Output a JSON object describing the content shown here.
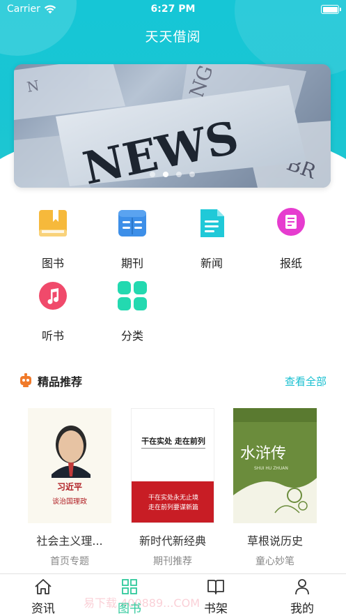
{
  "status_bar": {
    "carrier": "Carrier",
    "time": "6:27 PM"
  },
  "app": {
    "title": "天天借阅"
  },
  "banner": {
    "headline": "NEWS",
    "page_count": 4,
    "active_page": 1
  },
  "categories": [
    {
      "label": "图书",
      "icon": "book-icon",
      "color": "#f6b93b"
    },
    {
      "label": "期刊",
      "icon": "magazine-icon",
      "color": "#3d8fe8"
    },
    {
      "label": "新闻",
      "icon": "news-document-icon",
      "color": "#20c9d8"
    },
    {
      "label": "报纸",
      "icon": "newspaper-icon",
      "color": "#e63ccf"
    },
    {
      "label": "听书",
      "icon": "music-note-icon",
      "color": "#f04a6b"
    },
    {
      "label": "分类",
      "icon": "grid-category-icon",
      "color": "#23d9b0"
    }
  ],
  "recommend": {
    "title": "精品推荐",
    "view_all": "查看全部",
    "books": [
      {
        "title": "社会主义理...",
        "subtitle": "首页专题",
        "cover_text": [
          "习近平",
          "谈治国理政"
        ]
      },
      {
        "title": "新时代新经典",
        "subtitle": "期刊推荐",
        "cover_text": [
          "干在实处 走在前列",
          "干在实处永无止境",
          "走在前列要谋新篇"
        ]
      },
      {
        "title": "草根说历史",
        "subtitle": "童心妙笔",
        "cover_text": [
          "水浒传",
          "SHUI HU ZHUAN"
        ]
      }
    ]
  },
  "tabbar": {
    "tabs": [
      {
        "label": "资讯",
        "icon": "home-icon"
      },
      {
        "label": "图书",
        "icon": "grid-icon",
        "active": true
      },
      {
        "label": "书架",
        "icon": "open-book-icon"
      },
      {
        "label": "我的",
        "icon": "user-icon"
      }
    ],
    "watermark": "易下载 400889...COM"
  },
  "colors": {
    "accent": "#19c5d3",
    "active_tab": "#2fc99b",
    "link": "#17bfd0"
  }
}
